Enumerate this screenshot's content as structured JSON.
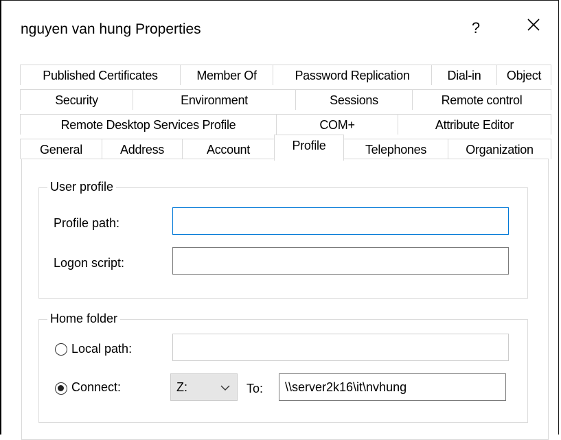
{
  "window": {
    "title": "nguyen van hung Properties",
    "help_label": "?"
  },
  "tabs": {
    "row1": [
      "Published Certificates",
      "Member Of",
      "Password Replication",
      "Dial-in",
      "Object"
    ],
    "row2": [
      "Security",
      "Environment",
      "Sessions",
      "Remote control"
    ],
    "row3": [
      "Remote Desktop Services Profile",
      "COM+",
      "Attribute Editor"
    ],
    "row4": [
      "General",
      "Address",
      "Account",
      "Profile",
      "Telephones",
      "Organization"
    ],
    "active": "Profile"
  },
  "user_profile": {
    "group_label": "User profile",
    "profile_path_label": "Profile path:",
    "profile_path_value": "",
    "logon_script_label": "Logon script:",
    "logon_script_value": ""
  },
  "home_folder": {
    "group_label": "Home folder",
    "local_path_label": "Local path:",
    "local_path_value": "",
    "connect_label": "Connect:",
    "drive_value": "Z:",
    "to_label": "To:",
    "to_value": "\\\\server2k16\\it\\nvhung",
    "selected": "connect"
  },
  "icons": {
    "close": "close-icon",
    "chevron": "chevron-down-icon"
  }
}
